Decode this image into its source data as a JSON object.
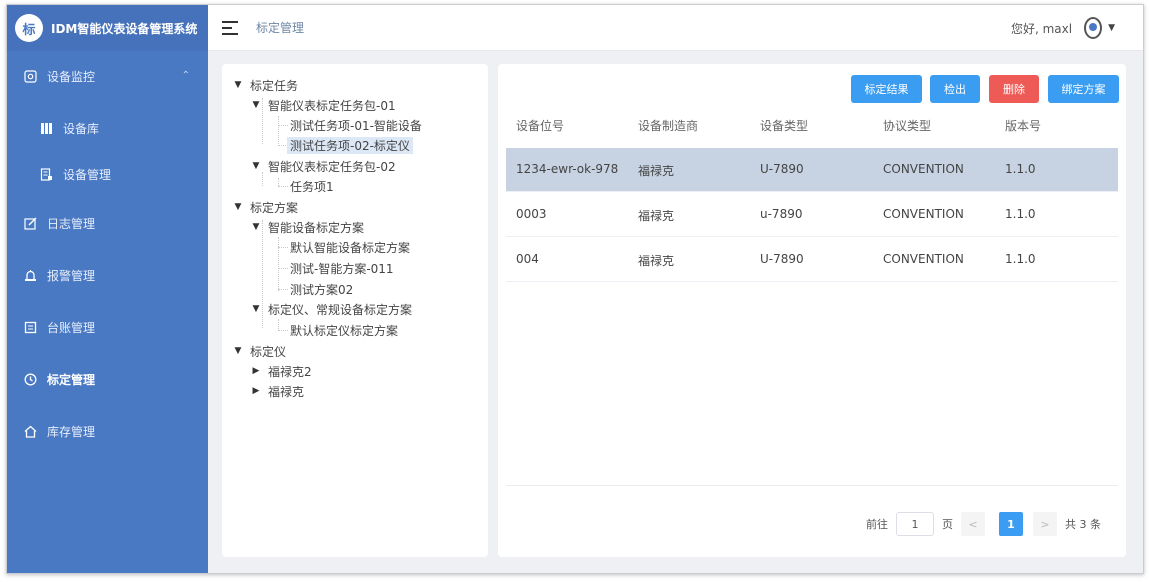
{
  "app": {
    "logo_text": "标",
    "title": "IDM智能仪表设备管理系统",
    "accent": "#4a79c4"
  },
  "sidebar": {
    "items": [
      {
        "label": "设备监控",
        "icon": "monitor-icon"
      },
      {
        "label": "设备库",
        "icon": "database-icon"
      },
      {
        "label": "设备管理",
        "icon": "device-icon"
      },
      {
        "label": "日志管理",
        "icon": "edit-icon"
      },
      {
        "label": "报警管理",
        "icon": "alarm-icon"
      },
      {
        "label": "台账管理",
        "icon": "ledger-icon"
      },
      {
        "label": "标定管理",
        "icon": "clock-icon"
      },
      {
        "label": "库存管理",
        "icon": "home-icon"
      }
    ]
  },
  "header": {
    "breadcrumb": "标定管理",
    "greeting": "您好, maxl"
  },
  "tree": {
    "nodes": [
      "标定任务",
      "智能仪表标定任务包-01",
      "测试任务项-01-智能设备",
      "测试任务项-02-标定仪",
      "智能仪表标定任务包-02",
      "任务项1",
      "标定方案",
      "智能设备标定方案",
      "默认智能设备标定方案",
      "测试-智能方案-011",
      "测试方案02",
      "标定仪、常规设备标定方案",
      "默认标定仪标定方案",
      "标定仪",
      "福禄克2",
      "福禄克"
    ]
  },
  "toolbar": {
    "result_label": "标定结果",
    "export_label": "检出",
    "delete_label": "删除",
    "bind_label": "绑定方案"
  },
  "table": {
    "columns": [
      "设备位号",
      "设备制造商",
      "设备类型",
      "协议类型",
      "版本号"
    ],
    "rows": [
      [
        "1234-ewr-ok-978",
        "福禄克",
        "U-7890",
        "CONVENTION",
        "1.1.0"
      ],
      [
        "0003",
        "福禄克",
        "u-7890",
        "CONVENTION",
        "1.1.0"
      ],
      [
        "004",
        "福禄克",
        "U-7890",
        "CONVENTION",
        "1.1.0"
      ]
    ]
  },
  "pagination": {
    "goto_label": "前往",
    "page_value": "1",
    "page_unit": "页",
    "prev": "<",
    "current": "1",
    "next": ">",
    "total_label": "共 3 条"
  }
}
